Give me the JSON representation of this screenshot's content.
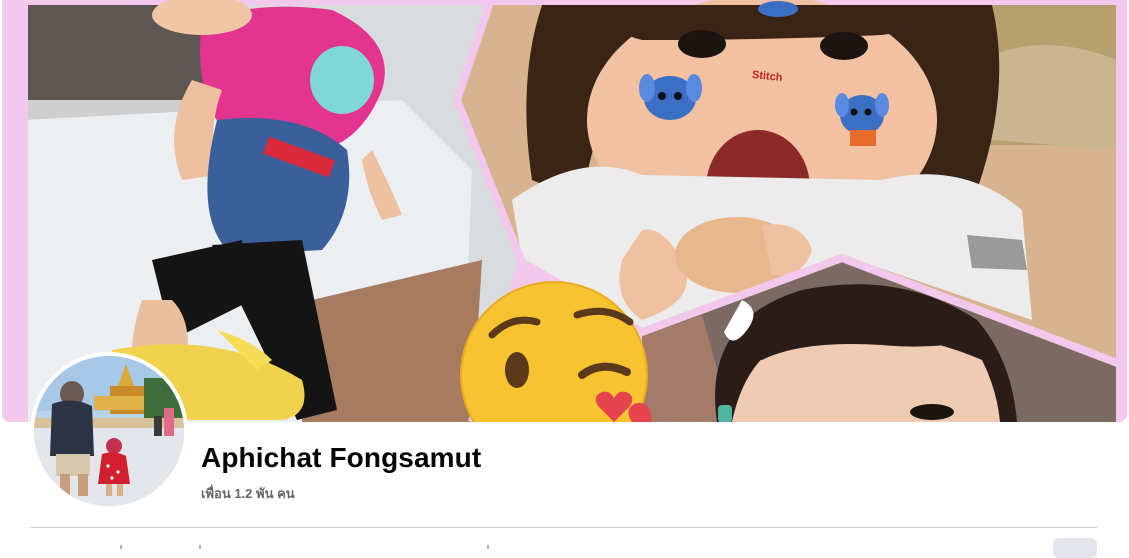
{
  "profile": {
    "name": "Aphichat Fongsamut",
    "friends": "เพื่อน 1.2 พัน คน"
  },
  "cover": {
    "sticker_text": "Stitch"
  },
  "colors": {
    "frame_pink": "#f2c9ec",
    "name_text": "#050505",
    "secondary_text": "#65676b",
    "divider": "#d0d2d6",
    "button_bg": "#e4e6eb"
  },
  "icons": [
    "wink-kiss-emoji-icon",
    "heart-icon"
  ]
}
